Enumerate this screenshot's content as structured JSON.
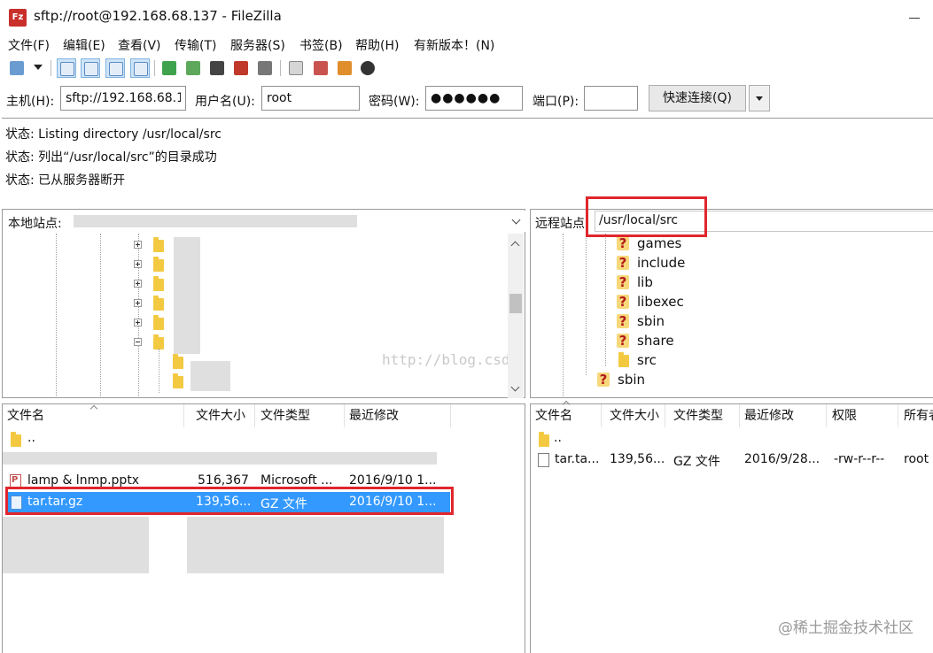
{
  "window": {
    "title": "sftp://root@192.168.68.137 - FileZilla",
    "app_icon_text": "Fz"
  },
  "menu": [
    "文件(F)",
    "编辑(E)",
    "查看(V)",
    "传输(T)",
    "服务器(S)",
    "书签(B)",
    "帮助(H)",
    "有新版本！(N)"
  ],
  "toolbar": {
    "icons": [
      "site-manager-icon",
      "layout-log-icon",
      "layout-tree-icon",
      "layout-remote-icon",
      "layout-queue-icon",
      "refresh-icon",
      "process-queue-icon",
      "cancel-icon",
      "disconnect-icon",
      "reconnect-icon",
      "filter-icon",
      "compare-icon",
      "sync-browse-icon",
      "search-icon"
    ]
  },
  "quickconnect": {
    "host_label": "主机(H):",
    "host_value": "sftp://192.168.68.1",
    "user_label": "用户名(U):",
    "user_value": "root",
    "pass_label": "密码(W):",
    "pass_value": "●●●●●●",
    "port_label": "端口(P):",
    "port_value": "",
    "connect_label": "快速连接(Q)"
  },
  "log": [
    {
      "prefix": "状态:",
      "text": "Listing directory /usr/local/src"
    },
    {
      "prefix": "状态:",
      "text": "列出“/usr/local/src”的目录成功"
    },
    {
      "prefix": "状态:",
      "text": "已从服务器断开"
    }
  ],
  "local": {
    "site_label": "本地站点:",
    "columns": [
      "文件名",
      "文件大小",
      "文件类型",
      "最近修改"
    ],
    "files": [
      {
        "name": "..",
        "size": "",
        "type": "",
        "modified": ""
      },
      {
        "name": "lamp & lnmp.pptx",
        "size": "516,367",
        "type": "Microsoft ...",
        "modified": "2016/9/10 1..."
      },
      {
        "name": "tar.tar.gz",
        "size": "139,56...",
        "type": "GZ 文件",
        "modified": "2016/9/10 1..."
      }
    ]
  },
  "remote": {
    "site_label": "远程站点",
    "path": "/usr/local/src",
    "tree": [
      "games",
      "include",
      "lib",
      "libexec",
      "sbin",
      "share",
      "src",
      "sbin"
    ],
    "columns": [
      "文件名",
      "文件大小",
      "文件类型",
      "最近修改",
      "权限",
      "所有者"
    ],
    "files": [
      {
        "name": "..",
        "size": "",
        "type": "",
        "modified": "",
        "perms": "",
        "owner": ""
      },
      {
        "name": "tar.ta...",
        "size": "139,56...",
        "type": "GZ 文件",
        "modified": "2016/9/28...",
        "perms": "-rw-r--r--",
        "owner": "root"
      }
    ]
  },
  "watermark": "http://blog.csdn.net/",
  "corner_watermark": "@稀土掘金技术社区",
  "colors": {
    "selection": "#3399ff",
    "highlight_box": "#e0262d"
  }
}
